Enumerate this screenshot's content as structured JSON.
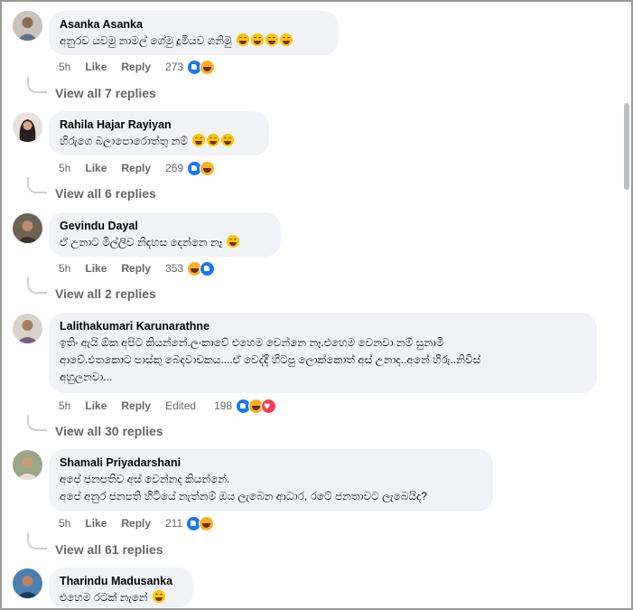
{
  "comments": [
    {
      "author": "Asanka Asanka",
      "text": "අනුරව යවමු නාමල් ගේමු දූමියව ගනිමු",
      "emoji_count": 4,
      "time": "5h",
      "like_label": "Like",
      "reply_label": "Reply",
      "reactions_count": "273",
      "reactions": [
        "like",
        "haha"
      ],
      "view_replies": "View all 7 replies",
      "avatar_color": "#b8b3ad"
    },
    {
      "author": "Rahila Hajar Rayiyan",
      "text": "හිරුගෙ බලාපොරොත්තු නම්",
      "emoji_count": 3,
      "time": "5h",
      "like_label": "Like",
      "reply_label": "Reply",
      "reactions_count": "269",
      "reactions": [
        "like",
        "haha"
      ],
      "view_replies": "View all 6 replies",
      "avatar_color": "#3a2a2a"
    },
    {
      "author": "Gevindu Dayal",
      "text": "ඒ උනාට මිල්ලිව නිදහස දෙන්නෙ නෑ",
      "emoji_count": 1,
      "time": "5h",
      "like_label": "Like",
      "reply_label": "Reply",
      "reactions_count": "353",
      "reactions": [
        "haha",
        "like"
      ],
      "view_replies": "View all 2 replies",
      "avatar_color": "#5a4a3a"
    },
    {
      "author": "Lalithakumari Karunarathne",
      "text": "ඉතිං ඇයි ඕක අපිට කියන්නේ.ලංකාවේ එහෙම වෙන්නෙ නෑ.එහෙම වෙනවා නම් සුනාමි\nආවේ.එතකොට පාස්කු බෙදවාචකය....ඒ වෙද්දි හිටපු ලොක්කොත් අස් උනාද..අනේ හිරු..නිවිස්\nඅහුලනවා...",
      "emoji_count": 0,
      "time": "5h",
      "like_label": "Like",
      "reply_label": "Reply",
      "edited_label": "Edited",
      "reactions_count": "198",
      "reactions": [
        "like",
        "haha",
        "love"
      ],
      "view_replies": "View all 30 replies",
      "avatar_color": "#c8c0b4"
    },
    {
      "author": "Shamali Priyadarshani",
      "text": "අපේ ජනපතිව අස් වෙන්නද කියන්නේ.\nඅපේ අනුර ජනපති හිටියේ නැත්නම් ඔය ලැබෙන ආධාර, රටේ ජනතාවට ලැබෙයිද?",
      "emoji_count": 0,
      "time": "5h",
      "like_label": "Like",
      "reply_label": "Reply",
      "reactions_count": "211",
      "reactions": [
        "like",
        "haha"
      ],
      "view_replies": "View all 61 replies",
      "avatar_color": "#7a8a6a"
    },
    {
      "author": "Tharindu Madusanka",
      "text": "එහෙම රටක් නැනේ",
      "emoji_count": 1,
      "avatar_color": "#2a5a8a"
    }
  ]
}
